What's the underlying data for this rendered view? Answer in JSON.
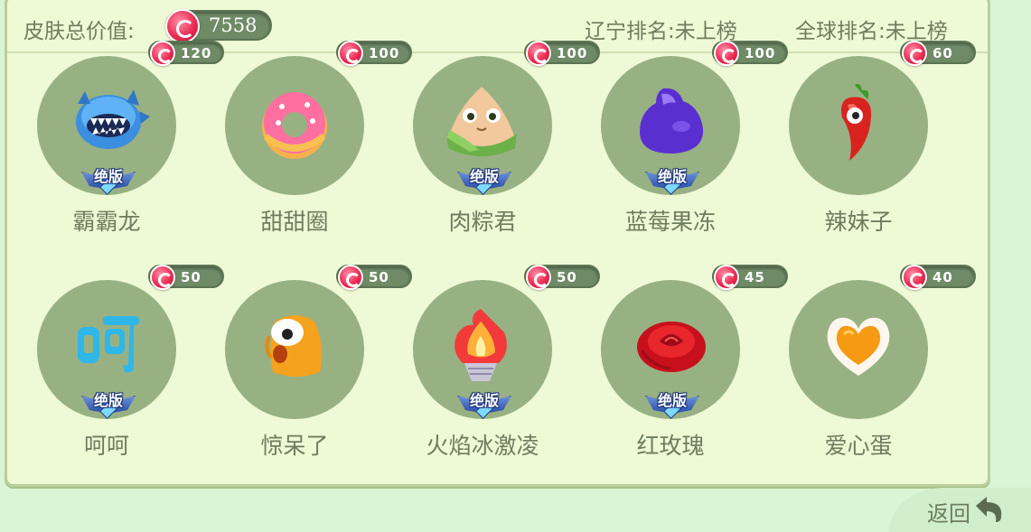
{
  "header": {
    "total_label": "皮肤总价值:",
    "total_value": "7558",
    "rank_liaoning": "辽宁排名:未上榜",
    "rank_global": "全球排名:未上榜"
  },
  "badge_label": "绝版",
  "skins": [
    {
      "name": "霸霸龙",
      "price": "120",
      "limited": true,
      "icon": "blue-monster-icon"
    },
    {
      "name": "甜甜圈",
      "price": "100",
      "limited": false,
      "icon": "donut-icon"
    },
    {
      "name": "肉粽君",
      "price": "100",
      "limited": true,
      "icon": "rice-dumpling-icon"
    },
    {
      "name": "蓝莓果冻",
      "price": "100",
      "limited": true,
      "icon": "blueberry-jelly-icon"
    },
    {
      "name": "辣妹子",
      "price": "60",
      "limited": false,
      "icon": "chili-pepper-icon"
    },
    {
      "name": "呵呵",
      "price": "50",
      "limited": true,
      "icon": "hehe-text-icon"
    },
    {
      "name": "惊呆了",
      "price": "50",
      "limited": false,
      "icon": "shocked-blob-icon"
    },
    {
      "name": "火焰冰激凌",
      "price": "50",
      "limited": true,
      "icon": "flame-icecream-icon"
    },
    {
      "name": "红玫瑰",
      "price": "45",
      "limited": true,
      "icon": "red-rose-icon"
    },
    {
      "name": "爱心蛋",
      "price": "40",
      "limited": false,
      "icon": "heart-egg-icon"
    }
  ],
  "footer": {
    "return_label": "返回",
    "return_icon": "return-arrow-icon"
  },
  "colors": {
    "background": "#d9f5d4",
    "panel": "#eef9d6",
    "circle": "#98b183",
    "text": "#6e7d5f",
    "pill": "#6f8b66",
    "candy": "#ec2c55"
  }
}
